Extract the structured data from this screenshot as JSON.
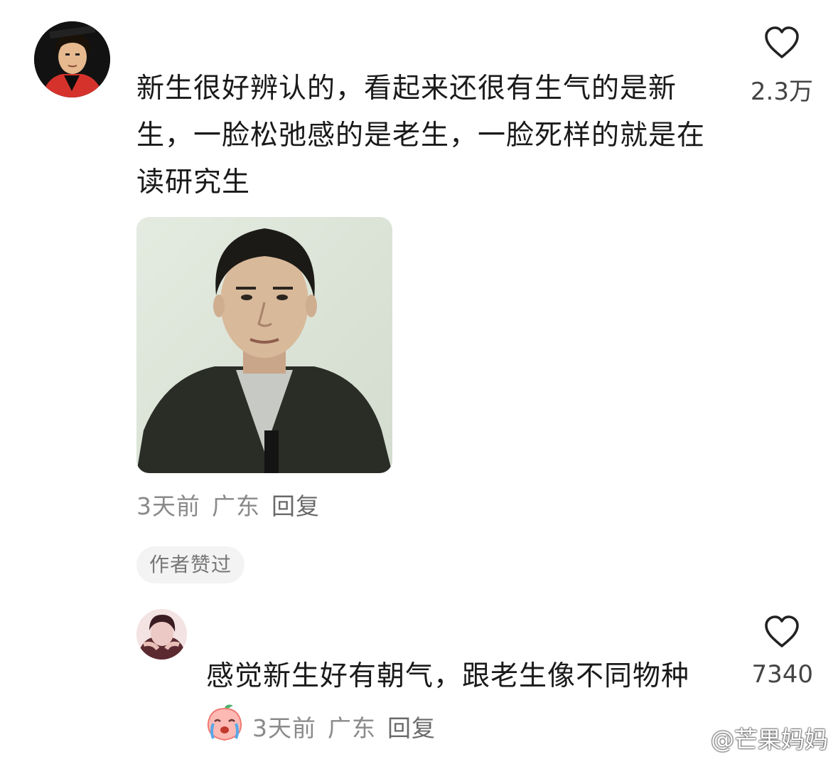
{
  "comments": [
    {
      "text": "新生很好辨认的，看起来还很有生气的是新生，一脸松弛感的是老生，一脸死样的就是在读研究生",
      "likes": "2.3万",
      "time": "3天前",
      "location": "广东",
      "reply_label": "回复",
      "badge": "作者赞过"
    },
    {
      "text": "感觉新生好有朝气，跟老生像不同物种",
      "likes": "7340",
      "time": "3天前",
      "location": "广东",
      "reply_label": "回复"
    }
  ],
  "watermark": "@芒果妈妈",
  "icons": {
    "like": "heart-outline-icon",
    "watermark": "weibo-logo-icon",
    "sticker": "crying-peach-emoji-icon"
  },
  "colors": {
    "text": "#1a1a1a",
    "meta": "#8a8a8a",
    "badge_bg": "#f3f3f3"
  }
}
